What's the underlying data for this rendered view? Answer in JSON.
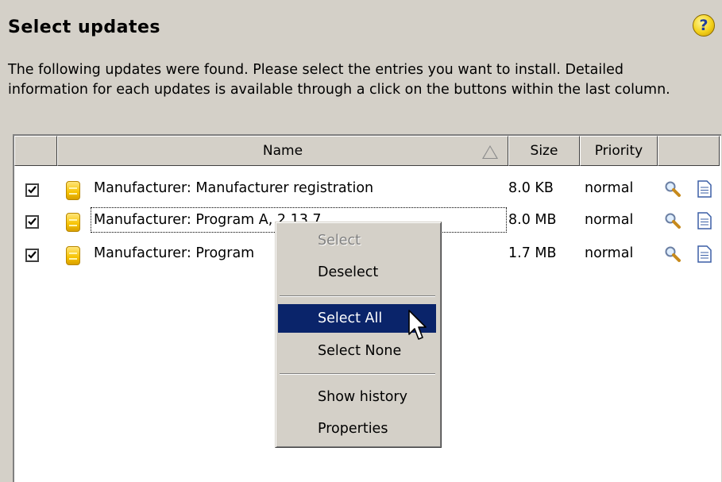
{
  "header": {
    "title": "Select updates",
    "help_icon": "help-icon",
    "help_symbol": "?",
    "description": "The following updates were found. Please select the entries you want to install. Detailed information for each updates is available through a click on the buttons within the last column."
  },
  "table": {
    "columns": {
      "check": "",
      "name": "Name",
      "size": "Size",
      "priority": "Priority",
      "actions": ""
    },
    "rows": [
      {
        "checked": true,
        "name": "Manufacturer: Manufacturer registration",
        "size": "8.0 KB",
        "priority": "normal"
      },
      {
        "checked": true,
        "name": "Manufacturer: Program A, 2.13.7",
        "size": "8.0 MB",
        "priority": "normal"
      },
      {
        "checked": true,
        "name": "Manufacturer: Program",
        "size": "1.7 MB",
        "priority": "normal"
      }
    ]
  },
  "context_menu": {
    "items": [
      {
        "label": "Select",
        "state": "disabled"
      },
      {
        "label": "Deselect",
        "state": "normal"
      },
      {
        "label": "Select All",
        "state": "highlighted"
      },
      {
        "label": "Select None",
        "state": "normal"
      },
      {
        "label": "Show history",
        "state": "normal"
      },
      {
        "label": "Properties",
        "state": "normal"
      }
    ]
  },
  "colors": {
    "dialog_bg": "#d4d0c8",
    "menu_highlight": "#0a246a",
    "list_bg": "#ffffff"
  }
}
